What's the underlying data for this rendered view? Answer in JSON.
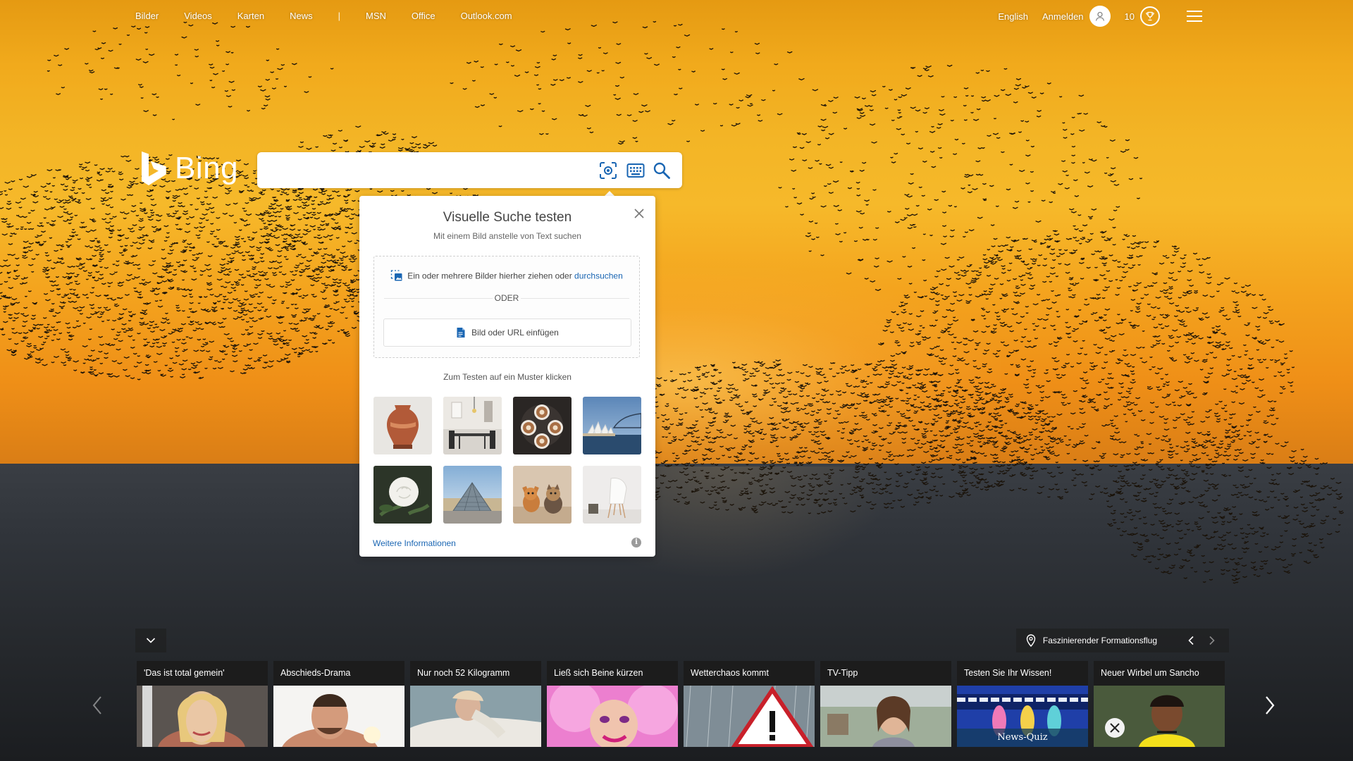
{
  "nav": {
    "left": [
      "Bilder",
      "Videos",
      "Karten",
      "News"
    ],
    "separator": "|",
    "left_secondary": [
      "MSN",
      "Office",
      "Outlook.com"
    ],
    "language": "English",
    "signin": "Anmelden",
    "points": "10"
  },
  "logo": {
    "text": "Bing"
  },
  "search": {
    "value": "",
    "placeholder": ""
  },
  "visual_search": {
    "title": "Visuelle Suche testen",
    "subtitle": "Mit einem Bild anstelle von Text suchen",
    "drop_text": "Ein oder mehrere Bilder hierher ziehen oder",
    "browse_link": "durchsuchen",
    "or": "ODER",
    "paste_button": "Bild oder URL einfügen",
    "samples_label": "Zum Testen auf ein Muster klicken",
    "more_info": "Weitere Informationen",
    "info_glyph": "i"
  },
  "carousel": {
    "caption": "Faszinierender Formationsflug",
    "cards": [
      {
        "title": "'Das ist total gemein'"
      },
      {
        "title": "Abschieds-Drama"
      },
      {
        "title": "Nur noch 52 Kilogramm"
      },
      {
        "title": "Ließ sich Beine kürzen"
      },
      {
        "title": "Wetterchaos kommt"
      },
      {
        "title": "TV-Tipp"
      },
      {
        "title": "Testen Sie Ihr Wissen!",
        "overlay": "News-Quiz"
      },
      {
        "title": "Neuer Wirbel um Sancho"
      }
    ]
  },
  "colors": {
    "link_blue": "#1a66b3",
    "sky_gold": "#f3b526",
    "sea_dark": "#2b2e33"
  }
}
